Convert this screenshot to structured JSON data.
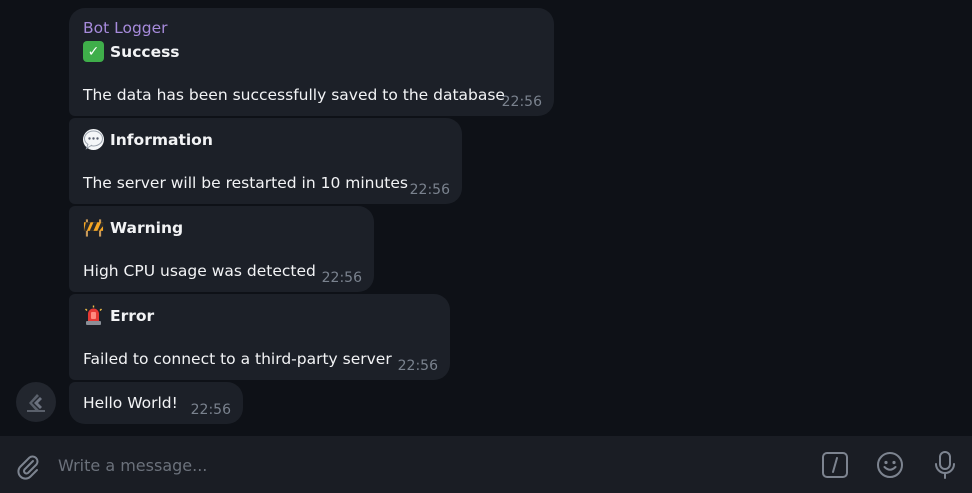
{
  "messages": [
    {
      "sender": "Bot Logger",
      "icon": "check-mark-emoji",
      "title": "Success",
      "text": "The data has been successfully saved to the database",
      "time": "22:56"
    },
    {
      "icon": "speech-bubble-emoji",
      "title": "Information",
      "text": "The server will be restarted in 10 minutes",
      "time": "22:56"
    },
    {
      "icon": "construction-barrier-emoji",
      "title": "Warning",
      "text": "High CPU usage was detected",
      "time": "22:56"
    },
    {
      "icon": "police-light-emoji",
      "title": "Error",
      "text": "Failed to connect to a third-party server",
      "time": "22:56"
    },
    {
      "text": "Hello World!",
      "time": "22:56"
    }
  ],
  "composer": {
    "placeholder": "Write a message..."
  },
  "colors": {
    "background": "#0e1117",
    "bubble": "#1c2028",
    "sender": "#a78bdc",
    "timestamp": "#7a828e",
    "composer": "#1a1d24"
  }
}
